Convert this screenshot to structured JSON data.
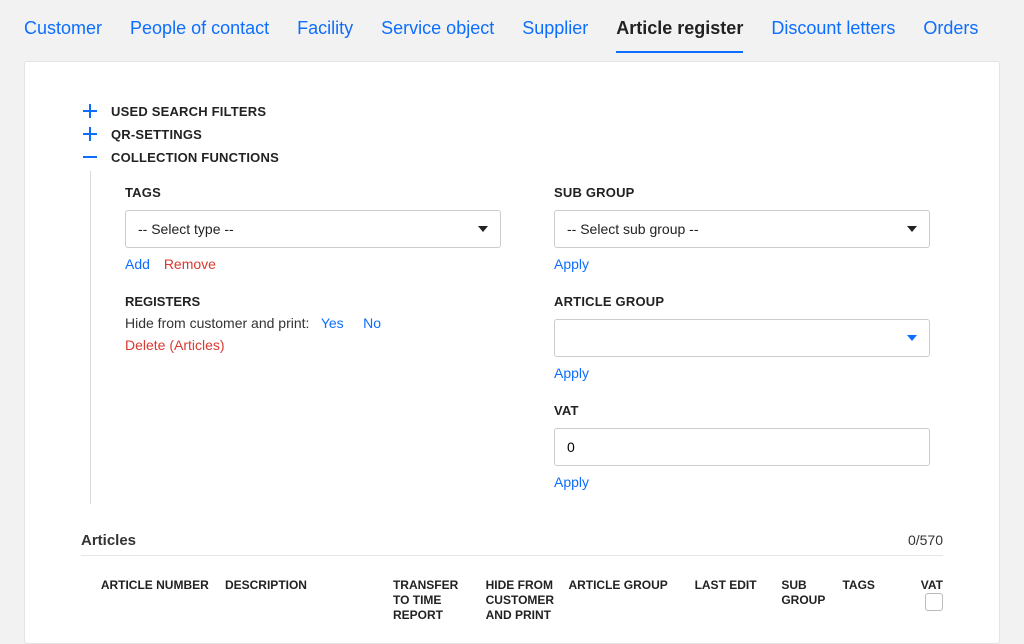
{
  "tabs": [
    {
      "label": "Customer",
      "active": false
    },
    {
      "label": "People of contact",
      "active": false
    },
    {
      "label": "Facility",
      "active": false
    },
    {
      "label": "Service object",
      "active": false
    },
    {
      "label": "Supplier",
      "active": false
    },
    {
      "label": "Article register",
      "active": true
    },
    {
      "label": "Discount letters",
      "active": false
    },
    {
      "label": "Orders",
      "active": false
    }
  ],
  "collapsibles": {
    "used_search_filters": "USED SEARCH FILTERS",
    "qr_settings": "QR-SETTINGS",
    "collection_functions": "COLLECTION FUNCTIONS"
  },
  "collection": {
    "tags": {
      "label": "TAGS",
      "placeholder": "-- Select type --",
      "add": "Add",
      "remove": "Remove"
    },
    "registers": {
      "label": "REGISTERS",
      "hide_text": "Hide from customer and print:",
      "yes": "Yes",
      "no": "No",
      "delete_articles": "Delete (Articles)"
    },
    "sub_group": {
      "label": "SUB GROUP",
      "placeholder": "-- Select sub group --",
      "apply": "Apply"
    },
    "article_group": {
      "label": "ARTICLE GROUP",
      "placeholder": "",
      "apply": "Apply"
    },
    "vat": {
      "label": "VAT",
      "value": "0",
      "apply": "Apply"
    }
  },
  "articles": {
    "title": "Articles",
    "count": "0/570",
    "columns": {
      "article_number": "ARTICLE NUMBER",
      "description": "DESCRIPTION",
      "transfer": "TRANSFER TO TIME REPORT",
      "hide": "HIDE FROM CUSTOMER AND PRINT",
      "article_group": "ARTICLE GROUP",
      "last_edit": "LAST EDIT",
      "sub_group": "SUB GROUP",
      "tags": "TAGS",
      "vat": "VAT"
    }
  }
}
